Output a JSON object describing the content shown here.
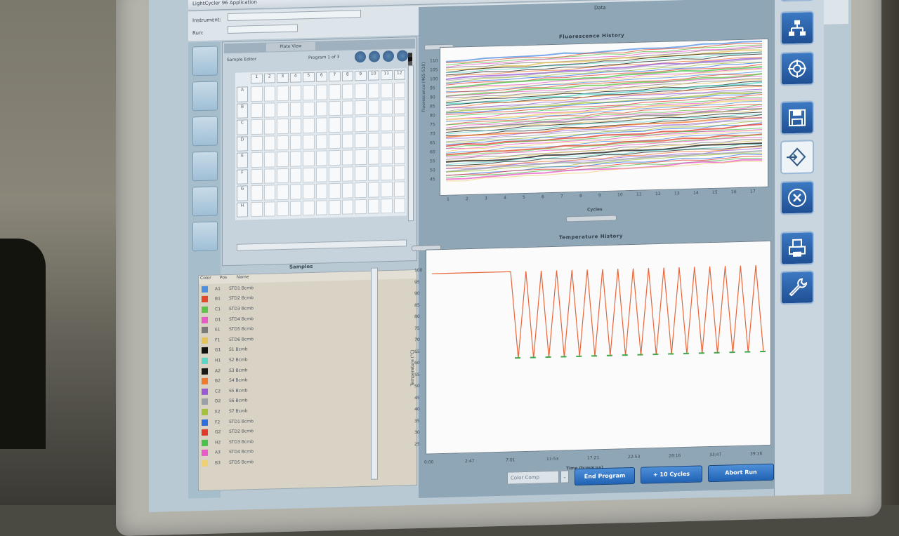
{
  "window": {
    "title": "LightCycler 96 Application"
  },
  "info": {
    "row1_label": "Instrument:",
    "row1_value": "",
    "row2_label": "Run:",
    "row2_value": "",
    "data_title": "Data"
  },
  "plate": {
    "tab_label": "Plate View",
    "control_label": "Sample Editor",
    "status_label": "Program 1 of 3",
    "col_headers": [
      "1",
      "2",
      "3",
      "4",
      "5",
      "6",
      "7",
      "8",
      "9",
      "10",
      "11",
      "12"
    ],
    "row_headers": [
      "A",
      "B",
      "C",
      "D",
      "E",
      "F",
      "G",
      "H"
    ]
  },
  "samples": {
    "title": "Samples",
    "headers": [
      "Color",
      "Pos",
      "Name"
    ],
    "rows": [
      {
        "color": "#4f8fe0",
        "pos": "A1",
        "name": "STD1 Bcmb"
      },
      {
        "color": "#e04a2a",
        "pos": "B1",
        "name": "STD2 Bcmb"
      },
      {
        "color": "#5fc24a",
        "pos": "C1",
        "name": "STD3 Bcmb"
      },
      {
        "color": "#e85ac8",
        "pos": "D1",
        "name": "STD4 Bcmb"
      },
      {
        "color": "#7a7a7a",
        "pos": "E1",
        "name": "STD5 Bcmb"
      },
      {
        "color": "#e5c35a",
        "pos": "F1",
        "name": "STD6 Bcmb"
      },
      {
        "color": "#111111",
        "pos": "G1",
        "name": "S1 Bcmb"
      },
      {
        "color": "#5ad6c8",
        "pos": "H1",
        "name": "S2 Bcmb"
      },
      {
        "color": "#1a1a1a",
        "pos": "A2",
        "name": "S3 Bcmb"
      },
      {
        "color": "#ef7a2e",
        "pos": "B2",
        "name": "S4 Bcmb"
      },
      {
        "color": "#9a5ad6",
        "pos": "C2",
        "name": "S5 Bcmb"
      },
      {
        "color": "#9aa0a8",
        "pos": "D2",
        "name": "S6 Bcmb"
      },
      {
        "color": "#a3c23a",
        "pos": "E2",
        "name": "S7 Bcmb"
      },
      {
        "color": "#2a6ee0",
        "pos": "F2",
        "name": "STD1 Bcmb"
      },
      {
        "color": "#e03a2a",
        "pos": "G2",
        "name": "STD2 Bcmb"
      },
      {
        "color": "#4ac24a",
        "pos": "H2",
        "name": "STD3 Bcmb"
      },
      {
        "color": "#e85ac8",
        "pos": "A3",
        "name": "STD4 Bcmb"
      },
      {
        "color": "#f0d070",
        "pos": "B3",
        "name": "STD5 Bcmb"
      }
    ]
  },
  "fluorescence": {
    "title": "Fluorescence History",
    "xlabel": "Cycles",
    "ylabel": "Fluorescence (465-510)",
    "x_ticks": [
      "1",
      "2",
      "3",
      "4",
      "5",
      "6",
      "7",
      "8",
      "9",
      "10",
      "11",
      "12",
      "13",
      "14",
      "15",
      "16",
      "17"
    ],
    "y_ticks": [
      "110",
      "105",
      "100",
      "95",
      "90",
      "85",
      "80",
      "75",
      "70",
      "65",
      "60",
      "55",
      "50",
      "45"
    ]
  },
  "temperature": {
    "title": "Temperature History",
    "xlabel": "Time (h:mm:ss)",
    "ylabel": "Temperature (°C)",
    "x_ticks": [
      "0:00",
      "2:47",
      "7:01",
      "11:53",
      "17:21",
      "22:53",
      "28:16",
      "33:47",
      "39:16"
    ],
    "y_ticks": [
      "100",
      "95",
      "90",
      "85",
      "80",
      "75",
      "70",
      "65",
      "60",
      "55",
      "50",
      "45",
      "40",
      "35",
      "30",
      "25"
    ]
  },
  "chart_data": {
    "type": "line",
    "title": "Temperature History",
    "xlabel": "Time (h:mm:ss)",
    "ylabel": "Temperature (°C)",
    "ylim": [
      25,
      100
    ],
    "series": [
      {
        "values": [
          95,
          95,
          95,
          95,
          60,
          95,
          60,
          95,
          60,
          95,
          60,
          95,
          60,
          95,
          60,
          95,
          60,
          95,
          60,
          95,
          60,
          95,
          60,
          95,
          60,
          95,
          60,
          95,
          60,
          95,
          60,
          95,
          60,
          95,
          60,
          95,
          60
        ]
      },
      {
        "values": [
          60,
          60,
          60,
          60,
          60,
          60,
          60,
          60,
          60,
          60,
          60,
          60,
          60,
          60,
          60,
          60,
          60,
          60,
          60
        ]
      }
    ]
  },
  "bottom": {
    "select_label": "Color Comp",
    "end_program": "End Program",
    "add_cycles": "+ 10 Cycles",
    "abort_run": "Abort Run"
  },
  "colors": {
    "accent": "#2063b5",
    "panel": "#b9c9d4"
  }
}
